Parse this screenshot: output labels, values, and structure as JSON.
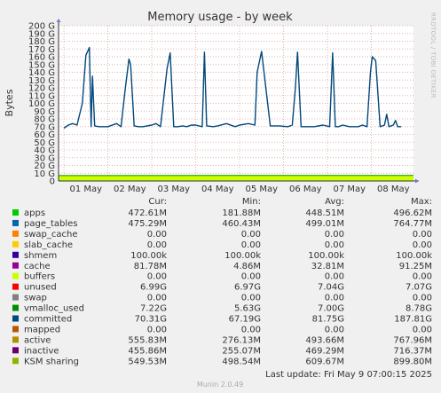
{
  "chart_data": {
    "type": "line",
    "title": "Memory usage - by week",
    "ylabel": "Bytes",
    "side_label": "RRDTOOL / TOBI OETIKER",
    "ylim": [
      0,
      200
    ],
    "y_unit": "G",
    "y_ticks": [
      "0",
      "10 G",
      "20 G",
      "30 G",
      "40 G",
      "50 G",
      "60 G",
      "70 G",
      "80 G",
      "90 G",
      "100 G",
      "110 G",
      "120 G",
      "130 G",
      "140 G",
      "150 G",
      "160 G",
      "170 G",
      "180 G",
      "190 G",
      "200 G"
    ],
    "x_ticks": [
      "01 May",
      "02 May",
      "03 May",
      "04 May",
      "05 May",
      "06 May",
      "07 May",
      "08 May"
    ],
    "grid": true,
    "columns": [
      "Cur:",
      "Min:",
      "Avg:",
      "Max:"
    ],
    "legend": [
      {
        "name": "apps",
        "color": "#00cc00",
        "cur": "472.61M",
        "min": "181.88M",
        "avg": "448.51M",
        "max": "496.62M"
      },
      {
        "name": "page_tables",
        "color": "#0066b3",
        "cur": "475.29M",
        "min": "460.43M",
        "avg": "499.01M",
        "max": "764.77M"
      },
      {
        "name": "swap_cache",
        "color": "#ff8000",
        "cur": "0.00",
        "min": "0.00",
        "avg": "0.00",
        "max": "0.00"
      },
      {
        "name": "slab_cache",
        "color": "#ffcc00",
        "cur": "0.00",
        "min": "0.00",
        "avg": "0.00",
        "max": "0.00"
      },
      {
        "name": "shmem",
        "color": "#330099",
        "cur": "100.00k",
        "min": "100.00k",
        "avg": "100.00k",
        "max": "100.00k"
      },
      {
        "name": "cache",
        "color": "#990099",
        "cur": "81.78M",
        "min": "4.86M",
        "avg": "32.81M",
        "max": "91.25M"
      },
      {
        "name": "buffers",
        "color": "#ccff00",
        "cur": "0.00",
        "min": "0.00",
        "avg": "0.00",
        "max": "0.00"
      },
      {
        "name": "unused",
        "color": "#ff0000",
        "cur": "6.99G",
        "min": "6.97G",
        "avg": "7.04G",
        "max": "7.07G"
      },
      {
        "name": "swap",
        "color": "#808080",
        "cur": "0.00",
        "min": "0.00",
        "avg": "0.00",
        "max": "0.00"
      },
      {
        "name": "vmalloc_used",
        "color": "#008f00",
        "cur": "7.22G",
        "min": "5.63G",
        "avg": "7.00G",
        "max": "8.78G"
      },
      {
        "name": "committed",
        "color": "#00487d",
        "cur": "70.31G",
        "min": "67.19G",
        "avg": "81.75G",
        "max": "187.81G"
      },
      {
        "name": "mapped",
        "color": "#b35a00",
        "cur": "0.00",
        "min": "0.00",
        "avg": "0.00",
        "max": "0.00"
      },
      {
        "name": "active",
        "color": "#b38f00",
        "cur": "555.83M",
        "min": "276.13M",
        "avg": "493.66M",
        "max": "767.96M"
      },
      {
        "name": "inactive",
        "color": "#6b006b",
        "cur": "455.86M",
        "min": "255.07M",
        "avg": "469.29M",
        "max": "716.37M"
      },
      {
        "name": "KSM sharing",
        "color": "#8fb300",
        "cur": "549.53M",
        "min": "498.54M",
        "avg": "609.67M",
        "max": "899.80M"
      }
    ],
    "series": [
      {
        "name": "unused",
        "type": "area",
        "color": "#ccff00",
        "values_G": [
          7.0,
          7.04,
          7.07,
          6.99
        ]
      },
      {
        "name": "vmalloc_used",
        "type": "line",
        "color": "#008f00",
        "values_G": [
          7.0,
          7.22
        ]
      },
      {
        "name": "committed",
        "type": "line",
        "color": "#00487d",
        "x_days": [
          0,
          0.1,
          0.2,
          0.3,
          0.42,
          0.5,
          0.58,
          0.62,
          0.65,
          0.7,
          0.8,
          1.0,
          1.2,
          1.3,
          1.4,
          1.48,
          1.52,
          1.6,
          1.7,
          1.8,
          2.0,
          2.1,
          2.2,
          2.35,
          2.42,
          2.5,
          2.6,
          2.7,
          2.8,
          2.9,
          3.0,
          3.15,
          3.2,
          3.25,
          3.4,
          3.5,
          3.7,
          3.9,
          4.0,
          4.2,
          4.35,
          4.4,
          4.5,
          4.7,
          4.9,
          5.1,
          5.2,
          5.27,
          5.32,
          5.4,
          5.5,
          5.7,
          5.9,
          6.05,
          6.12,
          6.18,
          6.25,
          6.35,
          6.5,
          6.7,
          6.8,
          6.9,
          6.98,
          7.02,
          7.1,
          7.2,
          7.3,
          7.35,
          7.4,
          7.5,
          7.55,
          7.6,
          7.68
        ],
        "values_G": [
          68,
          72,
          74,
          72,
          100,
          162,
          172,
          70,
          135,
          71,
          70,
          70,
          74,
          70,
          120,
          157,
          150,
          71,
          70,
          70,
          72,
          74,
          70,
          145,
          165,
          70,
          70,
          71,
          70,
          72,
          72,
          70,
          166,
          71,
          70,
          71,
          74,
          70,
          72,
          74,
          72,
          140,
          167,
          71,
          71,
          70,
          72,
          120,
          166,
          70,
          70,
          70,
          72,
          70,
          165,
          70,
          70,
          72,
          70,
          70,
          72,
          70,
          140,
          160,
          155,
          70,
          72,
          86,
          70,
          72,
          78,
          70,
          70
        ]
      }
    ],
    "last_update": "Last update: Fri May  9 07:00:15 2025",
    "footer": "Munin 2.0.49"
  }
}
